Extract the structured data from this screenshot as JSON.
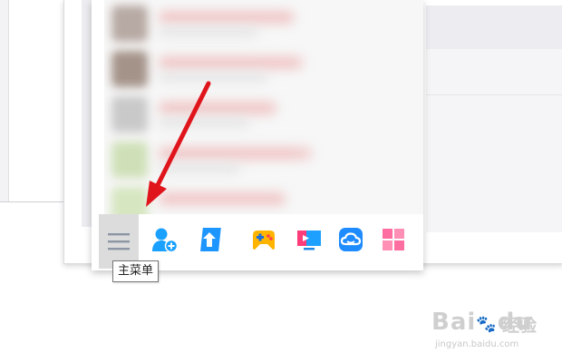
{
  "tooltip": {
    "text": "主菜单"
  },
  "toolbar": {
    "buttons": [
      {
        "name": "main-menu",
        "icon": "hamburger-menu-icon"
      },
      {
        "name": "add-contact",
        "icon": "add-contact-icon",
        "color": "#1aa0ff"
      },
      {
        "name": "transfer",
        "icon": "upload-arrow-icon",
        "color": "#1e96ff"
      },
      {
        "name": "game",
        "icon": "gamepad-icon",
        "color": "#ffb400"
      },
      {
        "name": "video",
        "icon": "tv-play-icon",
        "color": "#ff3c7a"
      },
      {
        "name": "cloud",
        "icon": "cloud-icon",
        "color": "#1e8bff"
      },
      {
        "name": "apps",
        "icon": "app-grid-icon",
        "color": "#ff6ea0"
      }
    ]
  },
  "watermark": {
    "brand": "Bai",
    "brand2": "du",
    "cn": "经验",
    "url": "jingyan.baidu.com"
  },
  "colors": {
    "arrow": "#e0141b"
  }
}
